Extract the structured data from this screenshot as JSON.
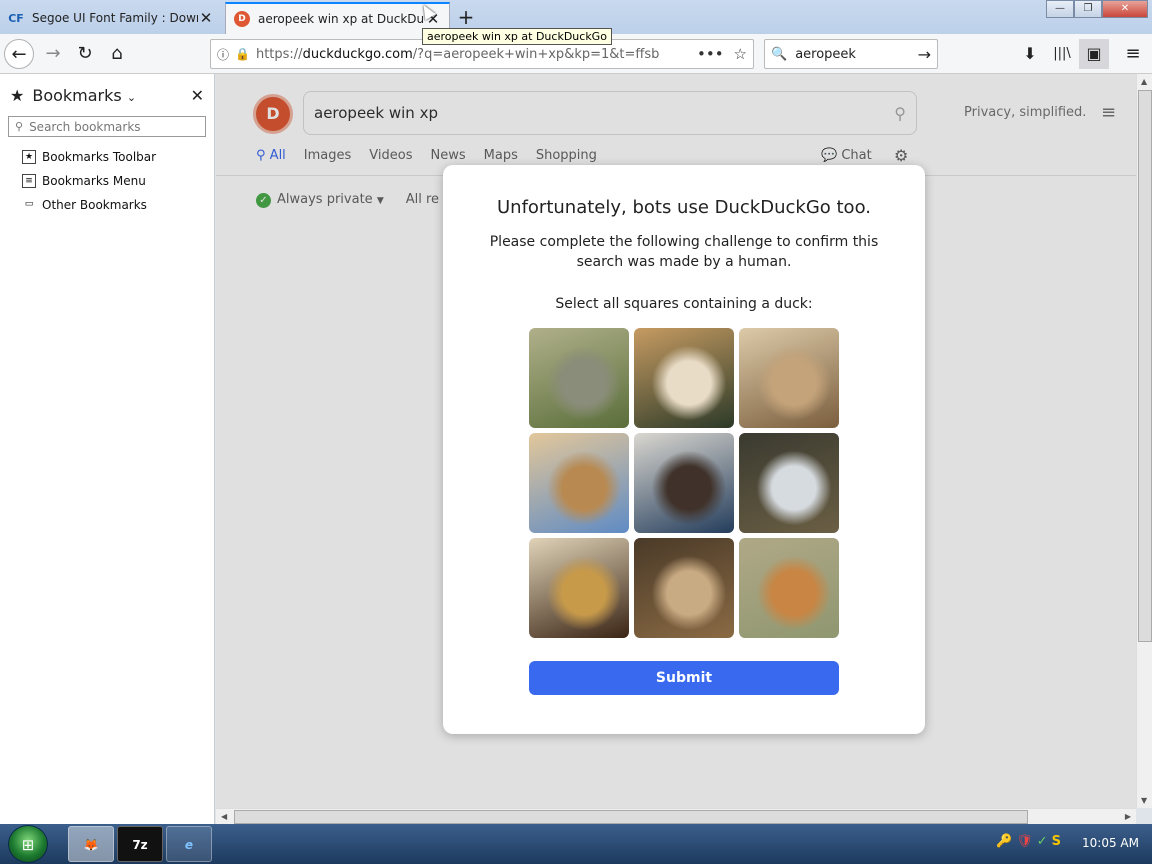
{
  "tabs": [
    {
      "favicon": "CF",
      "title": "Segoe UI Font Family : Downl",
      "close": "✕"
    },
    {
      "favicon": "D",
      "title": "aeropeek win xp at DuckDuckGo",
      "close": "✕"
    }
  ],
  "new_tab": "+",
  "tooltip": "aeropeek win xp at DuckDuckGo",
  "window_controls": {
    "minimize": "—",
    "maximize": "❐",
    "close": "✕"
  },
  "nav": {
    "back": "←",
    "forward": "→",
    "reload": "↻",
    "home": "⌂",
    "url_prefix": "https://",
    "url_host": "duckduckgo.com",
    "url_rest": "/?q=aeropeek+win+xp&kp=1&t=ffsb",
    "url_more": "•••",
    "url_star": "☆",
    "search_value": "aeropeek",
    "search_go": "→",
    "downloads": "⬇",
    "library": "|||\\",
    "sidebar_toggle": "▣",
    "menu": "≡"
  },
  "sidebar": {
    "title": "Bookmarks",
    "search_placeholder": "Search bookmarks",
    "items": [
      {
        "label": "Bookmarks Toolbar",
        "icon": "★"
      },
      {
        "label": "Bookmarks Menu",
        "icon": "≡"
      },
      {
        "label": "Other Bookmarks",
        "icon": "▭"
      }
    ]
  },
  "ddg": {
    "logo": "D",
    "query": "aeropeek win xp",
    "privacy": "Privacy, simplified.",
    "tabs": [
      "All",
      "Images",
      "Videos",
      "News",
      "Maps",
      "Shopping"
    ],
    "chat": "Chat",
    "filter_private": "Always private",
    "filter_region": "All re"
  },
  "captcha": {
    "title": "Unfortunately, bots use DuckDuckGo too.",
    "body": "Please complete the following challenge to confirm this search was made by a human.",
    "prompt": "Select all squares containing a duck:",
    "submit": "Submit",
    "tiles": [
      {
        "subject": "squirrel",
        "colors": [
          "#5a6e3a",
          "#8a8d7a",
          "#b0b08a"
        ]
      },
      {
        "subject": "owl",
        "colors": [
          "#2c3a28",
          "#e9dcc7",
          "#c69b62"
        ]
      },
      {
        "subject": "duckling",
        "colors": [
          "#7b5e3e",
          "#c4a37a",
          "#dccaa8"
        ]
      },
      {
        "subject": "giraffe",
        "colors": [
          "#5f8bc4",
          "#b88a52",
          "#e3c79a"
        ]
      },
      {
        "subject": "duck",
        "colors": [
          "#243d5c",
          "#40322a",
          "#dad7d0"
        ]
      },
      {
        "subject": "ducks",
        "colors": [
          "#6b5f44",
          "#d6dbe0",
          "#3a3a30"
        ]
      },
      {
        "subject": "giraffe",
        "colors": [
          "#3a2414",
          "#c79a4a",
          "#e0d3b8"
        ]
      },
      {
        "subject": "cobra",
        "colors": [
          "#8a6a44",
          "#c9ab83",
          "#4a3a28"
        ]
      },
      {
        "subject": "tiger",
        "colors": [
          "#8f9770",
          "#c98543",
          "#b0a887"
        ]
      }
    ]
  },
  "taskbar": {
    "start": "⊞",
    "tasks": [
      "🦊",
      "7z",
      "e"
    ],
    "tray": [
      "🔑",
      "🛡",
      "✓",
      "S"
    ],
    "clock": "10:05 AM"
  }
}
